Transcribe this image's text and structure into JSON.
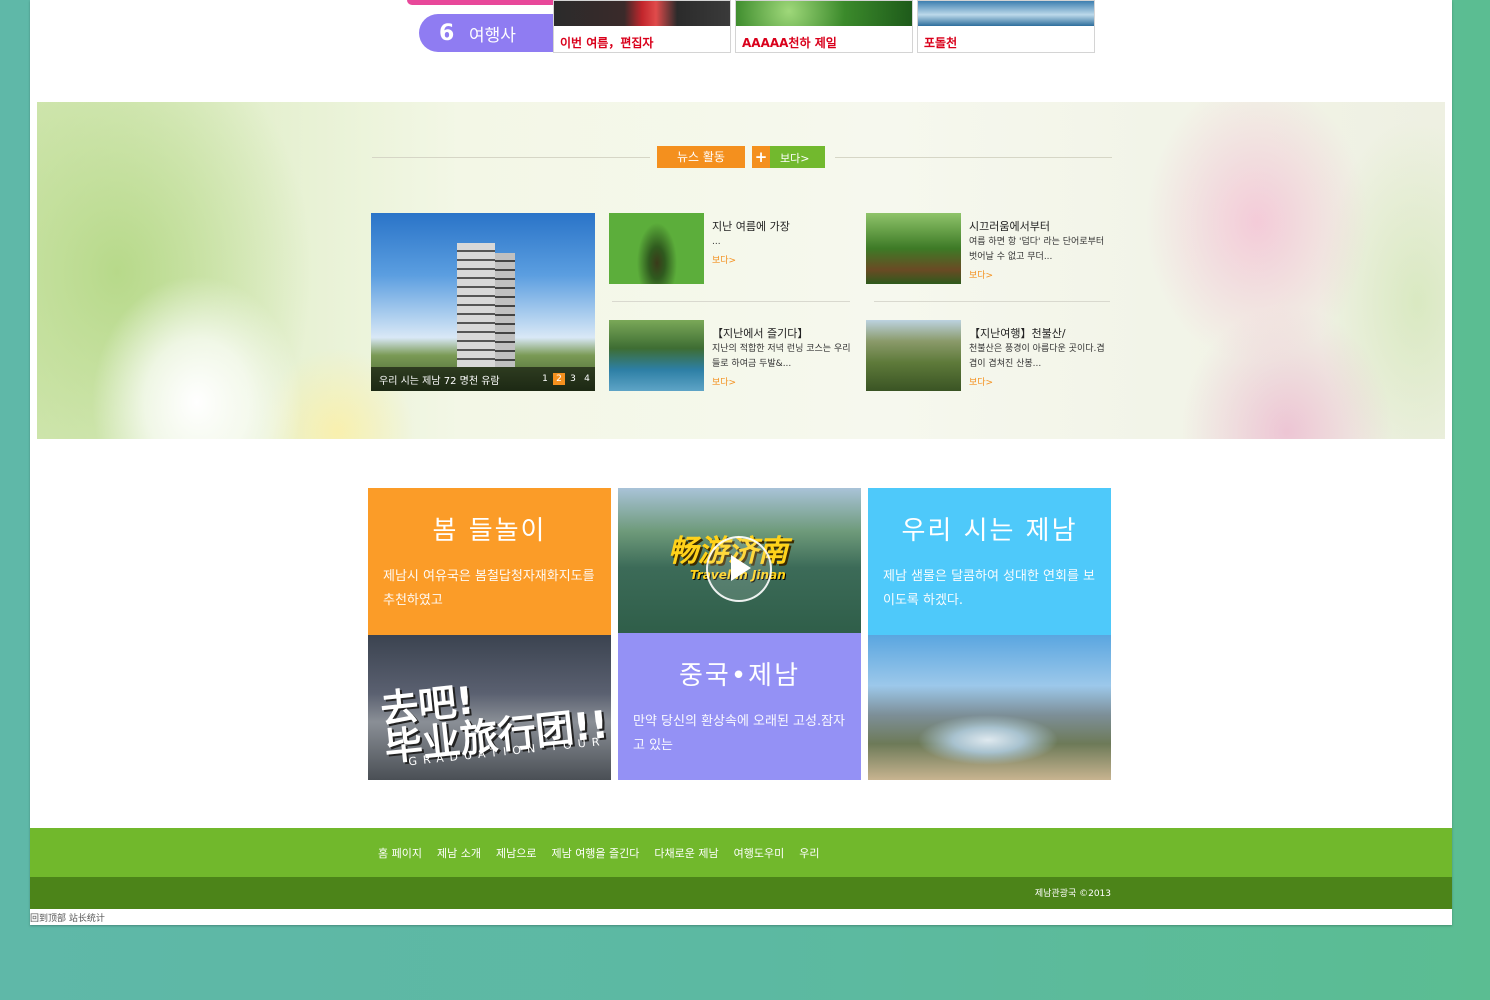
{
  "top_nav": {
    "item_number": "6",
    "item_label": "여행사"
  },
  "top_gallery": [
    {
      "caption": "이번 여름，편집자"
    },
    {
      "caption": "AAAAA천하 제일"
    },
    {
      "caption": "포돌천"
    }
  ],
  "news": {
    "section_title": "뉴스 활동",
    "more_label": "보다>",
    "feature": {
      "caption": "우리 시는 제남 72 명천 유람",
      "pages": [
        "1",
        "2",
        "3",
        "4"
      ],
      "active_page": "2"
    },
    "items": [
      {
        "title": "지난 여름에 가장",
        "desc": "...",
        "link": "보다>"
      },
      {
        "title": "시끄러움에서부터",
        "desc": "여름 하면 항 '덥다' 라는 단어로부터 벗어날 수 없고 무더...",
        "link": "보다>"
      },
      {
        "title": "【지난에서 즐기다】",
        "desc": "지난의 적합한 저녁 런닝 코스는 우리들로 하여금 두발&...",
        "link": "보다>"
      },
      {
        "title": "【지난여행】천불산/",
        "desc": "천불산은 풍경이 아름다운 곳이다.겹겹이 겹쳐진 산봉...",
        "link": "보다>"
      }
    ]
  },
  "tiles": {
    "spring": {
      "title": "봄 들놀이",
      "text": "제남시 여유국은 봄철답청자재화지도를 추천하였고"
    },
    "video": {
      "title": "畅游济南",
      "subtitle": "Travel in Jinan"
    },
    "china": {
      "title": "중국•제남",
      "text": "만약 당신의 환상속에 오래된 고성.잠자고 있는"
    },
    "city": {
      "title": "우리 시는 제남",
      "text": "제남 샘물은 달콤하여 성대한 연회를 보이도록 하겠다."
    },
    "graduation": {
      "title_line1": "去吧!",
      "title_line2": "毕业旅行团!!",
      "subtitle": "GRADUATION TOUR"
    }
  },
  "footer": {
    "links": [
      "홈 페이지",
      "제남 소개",
      "제남으로",
      "제남 여행을 즐긴다",
      "다채로운 제남",
      "여행도우미",
      "우리"
    ],
    "copyright": "제남관광국 ©2013"
  },
  "bottom_links": "回到顶部 站长统计",
  "colors": {
    "orange": "#f4901e",
    "green": "#71b82c",
    "dark_green": "#4c8419",
    "tile_orange": "#fb9c28",
    "tile_purple": "#9491f5",
    "tile_blue": "#4ec9fa",
    "nav_purple": "#8f7cf2"
  }
}
